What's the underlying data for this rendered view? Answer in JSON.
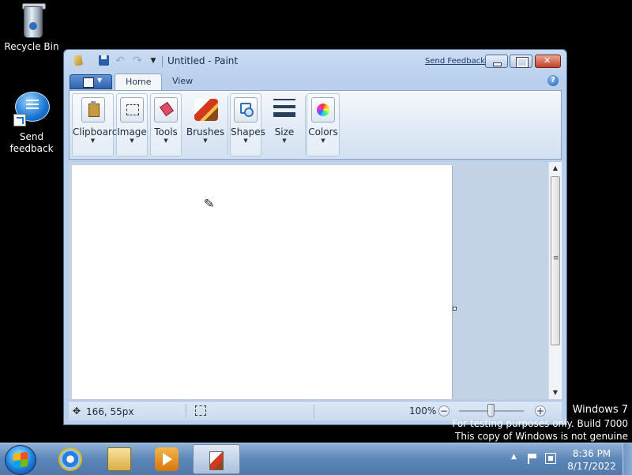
{
  "desktop": {
    "icons": [
      {
        "label": "Recycle Bin",
        "icon": "recycle-bin-icon"
      },
      {
        "label": "Send\nfeedback",
        "line1": "Send",
        "line2": "feedback",
        "icon": "send-feedback-icon"
      }
    ],
    "watermark": {
      "line1": "Windows 7",
      "line2": "For testing purposes only. Build 7000",
      "line3": "This copy of Windows is not genuine"
    }
  },
  "window": {
    "title": "Untitled - Paint",
    "send_feedback": "Send Feedback",
    "quick_access": [
      "save-icon",
      "undo-icon",
      "redo-icon",
      "customize-dropdown-icon"
    ]
  },
  "ribbon": {
    "tabs": [
      {
        "label": "Home",
        "active": true
      },
      {
        "label": "View",
        "active": false
      }
    ],
    "groups": [
      {
        "label": "Clipboard",
        "icon": "clipboard-icon"
      },
      {
        "label": "Image",
        "icon": "image-select-icon"
      },
      {
        "label": "Tools",
        "icon": "tools-icon"
      },
      {
        "label": "Brushes",
        "icon": "brushes-icon"
      },
      {
        "label": "Shapes",
        "icon": "shapes-icon"
      },
      {
        "label": "Size",
        "icon": "size-icon"
      },
      {
        "label": "Colors",
        "icon": "colors-icon"
      }
    ]
  },
  "statusbar": {
    "cursor_position": "166, 55px",
    "zoom": "100%",
    "zoom_out": "−",
    "zoom_in": "+"
  },
  "taskbar": {
    "apps": [
      "internet-explorer-icon",
      "windows-explorer-icon",
      "media-player-icon",
      "paint-icon"
    ],
    "clock_time": "8:36 PM",
    "clock_date": "8/17/2022"
  },
  "colors": {
    "desktop_bg": "#000000",
    "window_frame": "#b9cfec",
    "close_button": "#c4402a",
    "canvas": "#ffffff"
  }
}
